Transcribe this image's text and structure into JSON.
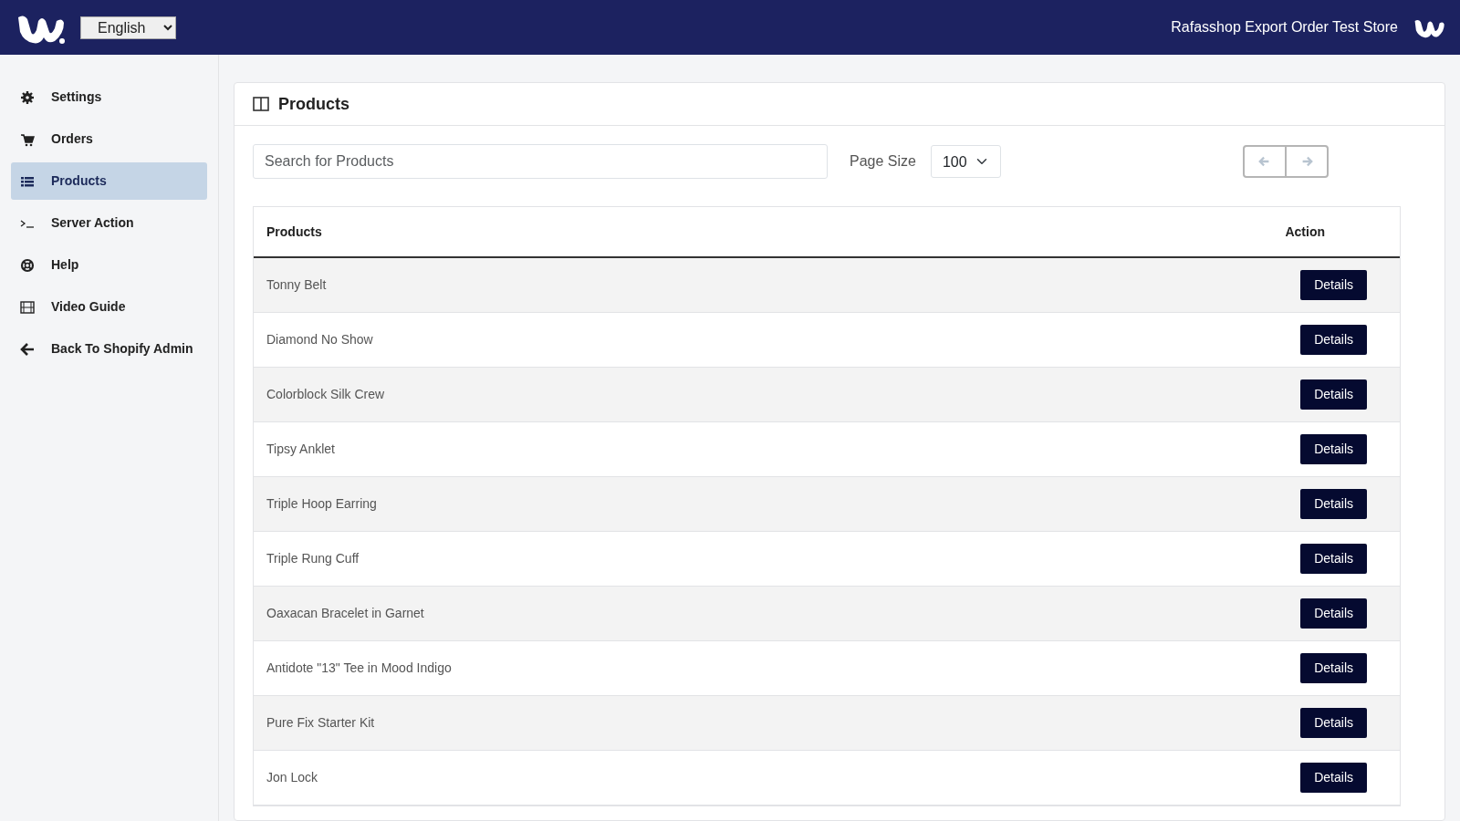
{
  "header": {
    "language": "English",
    "store_name": "Rafasshop Export Order Test Store"
  },
  "sidebar": {
    "items": [
      {
        "label": "Settings",
        "selected": false
      },
      {
        "label": "Orders",
        "selected": false
      },
      {
        "label": "Products",
        "selected": true
      },
      {
        "label": "Server Action",
        "selected": false
      },
      {
        "label": "Help",
        "selected": false
      },
      {
        "label": "Video Guide",
        "selected": false
      },
      {
        "label": "Back To Shopify Admin",
        "selected": false
      }
    ]
  },
  "panel": {
    "title": "Products",
    "search": {
      "placeholder": "Search for Products"
    },
    "page_size": {
      "label": "Page Size",
      "value": "100"
    },
    "pager": {
      "prev_disabled": true,
      "next_disabled": true
    }
  },
  "table": {
    "columns": [
      "Products",
      "Action"
    ],
    "rows": [
      {
        "name": "Tonny Belt",
        "action": "Details"
      },
      {
        "name": "Diamond No Show",
        "action": "Details"
      },
      {
        "name": "Colorblock Silk Crew",
        "action": "Details"
      },
      {
        "name": "Tipsy Anklet",
        "action": "Details"
      },
      {
        "name": "Triple Hoop Earring",
        "action": "Details"
      },
      {
        "name": "Triple Rung Cuff",
        "action": "Details"
      },
      {
        "name": "Oaxacan Bracelet in Garnet",
        "action": "Details"
      },
      {
        "name": "Antidote \"13\" Tee in Mood Indigo",
        "action": "Details"
      },
      {
        "name": "Pure Fix Starter Kit",
        "action": "Details"
      },
      {
        "name": "Jon Lock",
        "action": "Details"
      }
    ]
  }
}
